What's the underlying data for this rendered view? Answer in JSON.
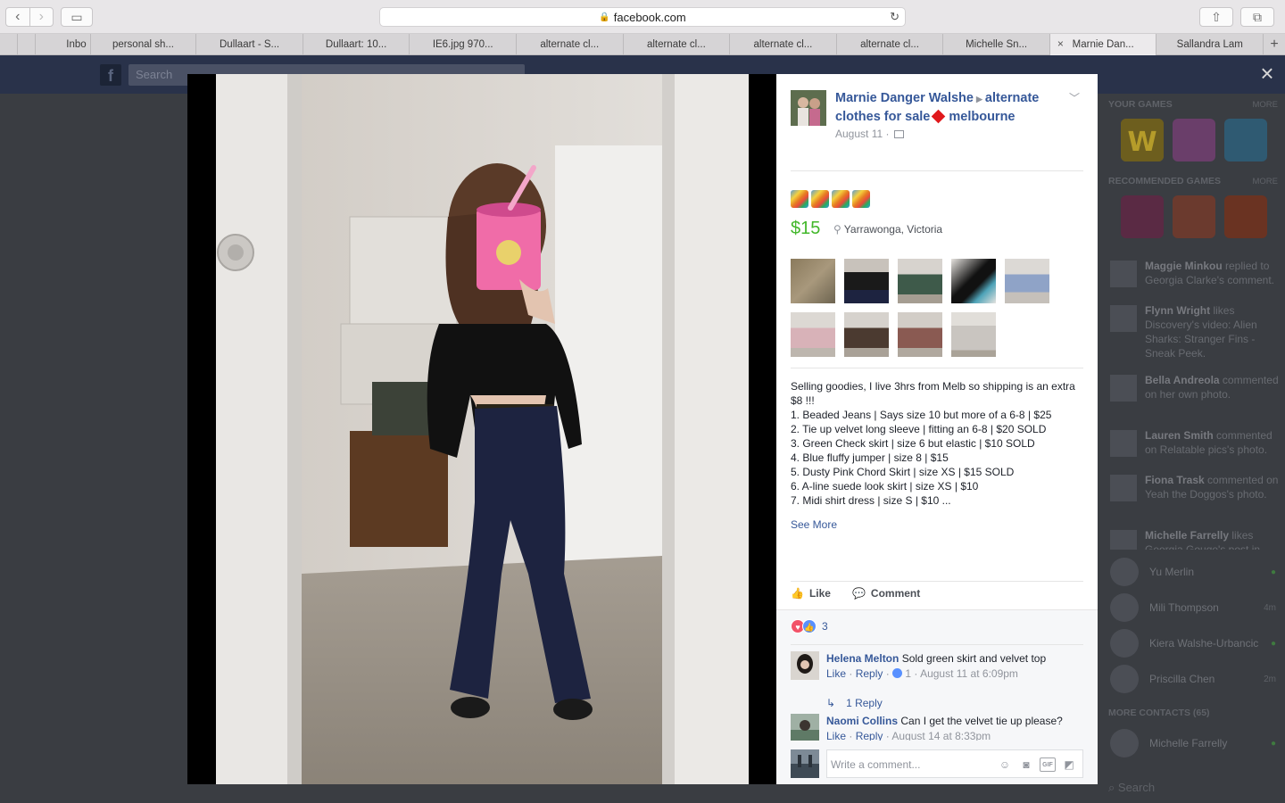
{
  "browser": {
    "url": "facebook.com",
    "tabs": [
      "Inbo",
      "personal sh...",
      "Dullaart - S...",
      "Dullaart: 10...",
      "IE6.jpg 970...",
      "alternate cl...",
      "alternate cl...",
      "alternate cl...",
      "alternate cl...",
      "Michelle Sn...",
      "Marnie Dan...",
      "Sallandra Lam"
    ],
    "active_tab": 10
  },
  "fb": {
    "logo": "f",
    "search_placeholder": "Search",
    "close": "×"
  },
  "post": {
    "author": "Marnie Danger Walshe",
    "group_part1": "alternate clothes for sale",
    "group_part2": "melbourne",
    "date": "August 11 ·",
    "price": "$15",
    "location": "Yarrawonga, Victoria",
    "description": [
      "Selling goodies, I live 3hrs from Melb so shipping is an extra $8 !!!",
      "1. Beaded Jeans | Says size 10 but more of a 6-8 | $25",
      "2. Tie up velvet long sleeve | fitting an 6-8 | $20 SOLD",
      "3. Green Check skirt | size 6 but elastic | $10 SOLD",
      "4. Blue fluffy jumper | size 8 | $15",
      "5. Dusty Pink Chord Skirt | size XS | $15 SOLD",
      "6. A-line suede look skirt | size XS | $10",
      "7. Midi shirt dress | size S | $10 ..."
    ],
    "see_more": "See More",
    "like_label": "Like",
    "comment_label": "Comment",
    "reaction_count": "3"
  },
  "comments": [
    {
      "name": "Helena Melton",
      "text": "Sold green skirt and velvet top",
      "like": "Like",
      "reply": "Reply",
      "meta": "1 · August 11 at 6:09pm",
      "replies": "1 Reply"
    },
    {
      "name": "Naomi Collins",
      "text": "Can I get the velvet tie up please?",
      "like": "Like",
      "reply": "Reply",
      "meta": "August 14 at 8:33pm"
    }
  ],
  "write_comment_placeholder": "Write a comment...",
  "sidebar": {
    "your_games": "YOUR GAMES",
    "recommended_games": "RECOMMENDED GAMES",
    "more": "MORE",
    "news": [
      {
        "name": "Maggie Minkou",
        "rest": "replied to Georgia Clarke's comment."
      },
      {
        "name": "Flynn Wright",
        "rest": "likes Discovery's video: Alien Sharks: Stranger Fins - Sneak Peek."
      },
      {
        "name": "Bella Andreola",
        "rest": "commented on her own photo."
      },
      {
        "name": "Lauren Smith",
        "rest": "commented on Relatable pics's photo."
      },
      {
        "name": "Fiona Trask",
        "rest": "commented on Yeah the Doggos's photo."
      },
      {
        "name": "Michelle Farrelly",
        "rest": "likes Georgia Gouge's post in..."
      }
    ],
    "contacts": [
      {
        "name": "Yu Merlin",
        "status": "●"
      },
      {
        "name": "Mili Thompson",
        "status": "4m"
      },
      {
        "name": "Kiera Walshe-Urbancic",
        "status": "●"
      },
      {
        "name": "Priscilla Chen",
        "status": "2m"
      }
    ],
    "more_contacts": "MORE CONTACTS (65)",
    "extra_contact": {
      "name": "Michelle Farrelly",
      "status": "●"
    },
    "search": "Search"
  },
  "colors": {
    "fb_blue": "#365899",
    "price_green": "#42b72a"
  }
}
